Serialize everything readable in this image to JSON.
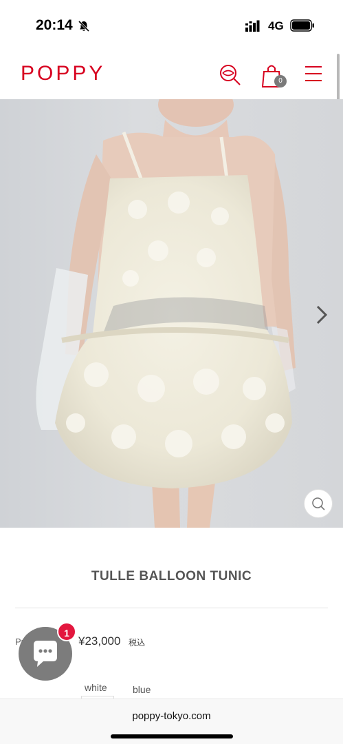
{
  "status_bar": {
    "time": "20:14",
    "network": "4G",
    "icons": [
      "bell-muted-icon",
      "signal-icon",
      "battery-icon"
    ]
  },
  "header": {
    "logo": "POPPY",
    "brand_color": "#d7001f",
    "cart_count": "0",
    "icons": [
      "search-icon",
      "shopping-bag-icon",
      "menu-icon"
    ]
  },
  "hero": {
    "icons": [
      "chevron-right-icon",
      "zoom-icon"
    ]
  },
  "product": {
    "title": "TULLE BALLOON TUNIC",
    "price_label": "Pr",
    "price": "¥23,000",
    "tax_label": "税込",
    "variants": [
      "white",
      "blue"
    ]
  },
  "chat": {
    "badge_count": "1",
    "icon": "chat-bubble-icon"
  },
  "browser": {
    "url": "poppy-tokyo.com"
  }
}
